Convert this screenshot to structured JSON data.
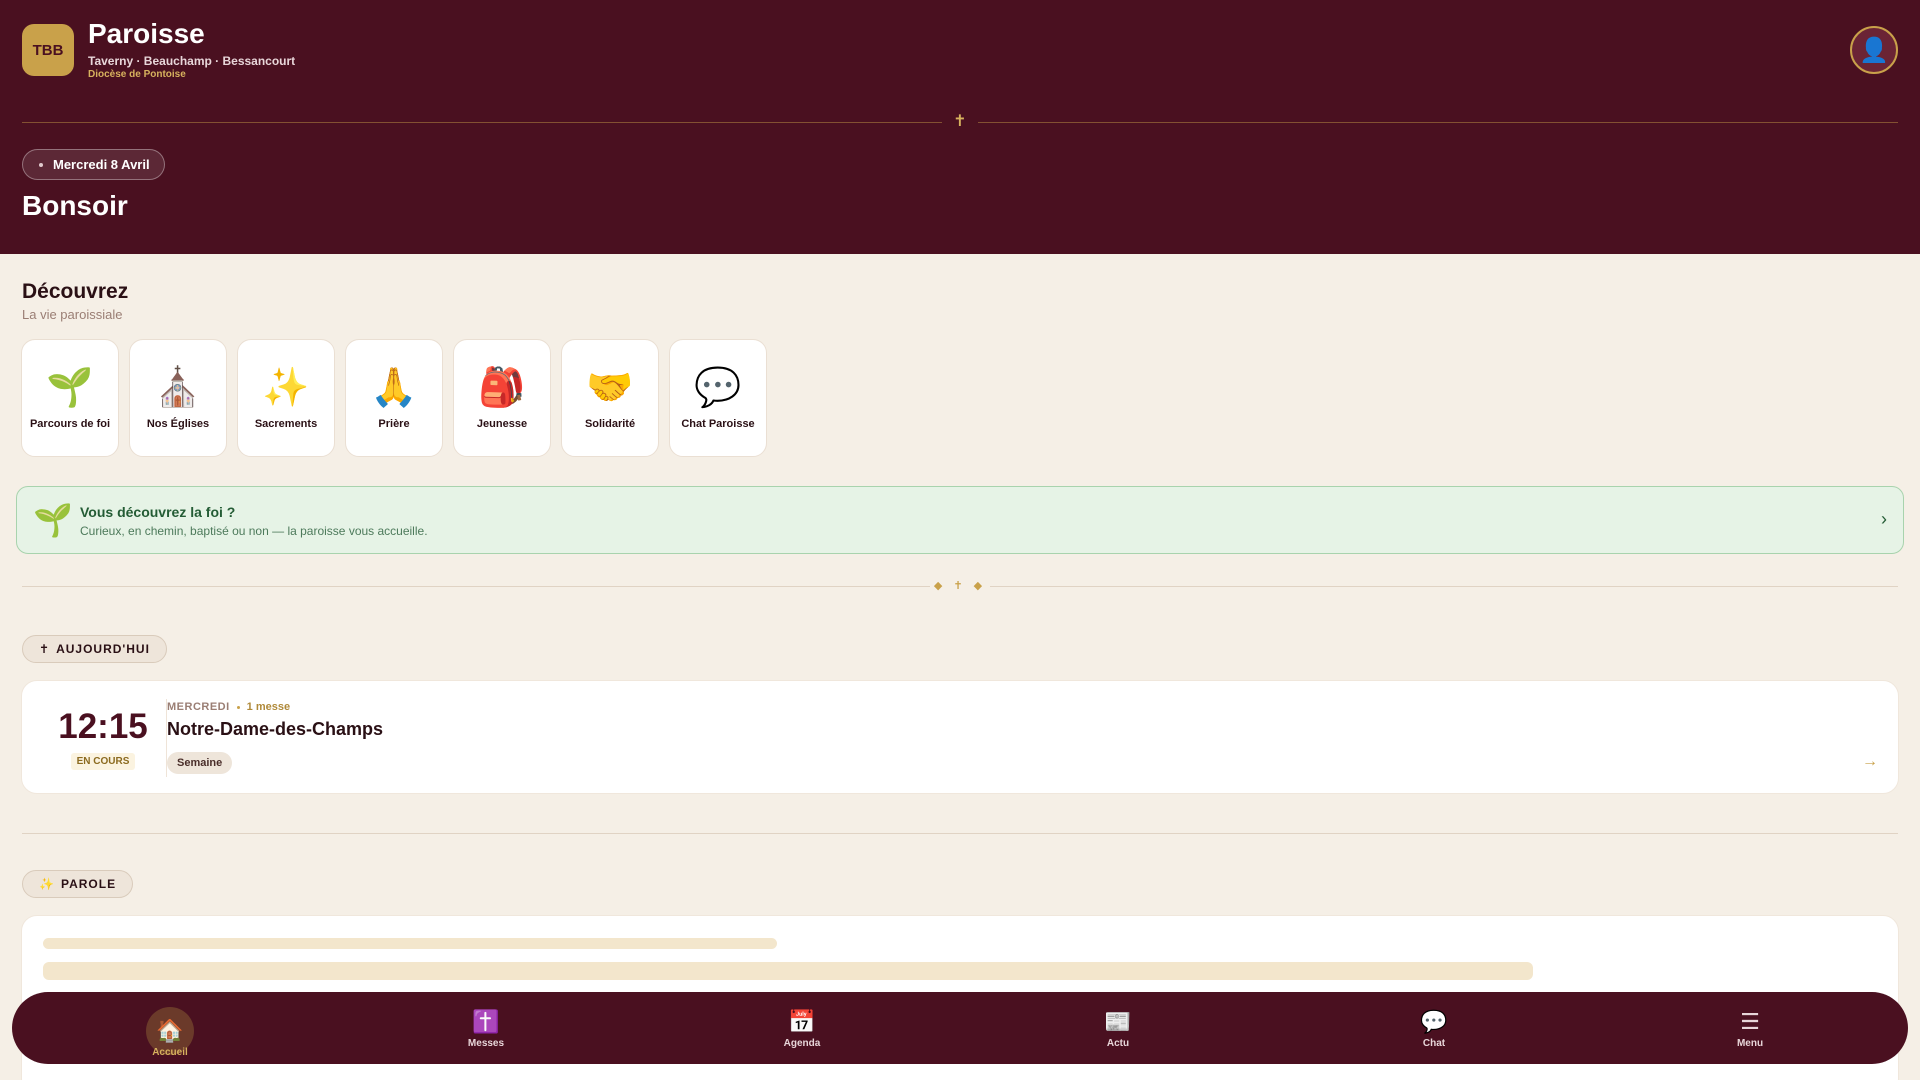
{
  "header": {
    "logo_text": "TBB",
    "title": "Paroisse",
    "subtitle": "Taverny · Beauchamp · Bessancourt",
    "diocese": "Diocèse de Pontoise",
    "avatar_icon": "👤",
    "cross_icon": "✝",
    "date": "Mercredi 8 Avril",
    "greeting": "Bonsoir"
  },
  "discover": {
    "title": "Découvrez",
    "subtitle": "La vie paroissiale",
    "tiles": [
      {
        "icon": "🌱",
        "label": "Parcours de foi"
      },
      {
        "icon": "⛪",
        "label": "Nos Églises"
      },
      {
        "icon": "✨",
        "label": "Sacrements"
      },
      {
        "icon": "🙏",
        "label": "Prière"
      },
      {
        "icon": "🎒",
        "label": "Jeunesse"
      },
      {
        "icon": "🤝",
        "label": "Solidarité"
      },
      {
        "icon": "💬",
        "label": "Chat Paroisse"
      }
    ]
  },
  "faith_banner": {
    "icon": "🌱",
    "title": "Vous découvrez la foi ?",
    "subtitle": "Curieux, en chemin, baptisé ou non — la paroisse vous accueille.",
    "chevron": "›"
  },
  "ornament": "◆ ✝ ◆",
  "today": {
    "pill_icon": "✝",
    "pill_label": "AUJOURD'HUI",
    "mass": {
      "time": "12:15",
      "status": "EN COURS",
      "day": "MERCREDI",
      "count": "1 messe",
      "church": "Notre-Dame-des-Champs",
      "tag": "Semaine",
      "arrow": "→"
    }
  },
  "parole": {
    "pill_icon": "✨",
    "pill_label": "PAROLE"
  },
  "bottom_nav": [
    {
      "icon": "🏠",
      "label": "Accueil",
      "active": true
    },
    {
      "icon": "✝️",
      "label": "Messes"
    },
    {
      "icon": "📅",
      "label": "Agenda"
    },
    {
      "icon": "📰",
      "label": "Actu"
    },
    {
      "icon": "💬",
      "label": "Chat"
    },
    {
      "icon": "☰",
      "label": "Menu"
    }
  ],
  "colors": {
    "primary": "#4a1020",
    "gold": "#c9a14a",
    "background": "#f5efe6",
    "faith_green": "#e6f3e6"
  }
}
